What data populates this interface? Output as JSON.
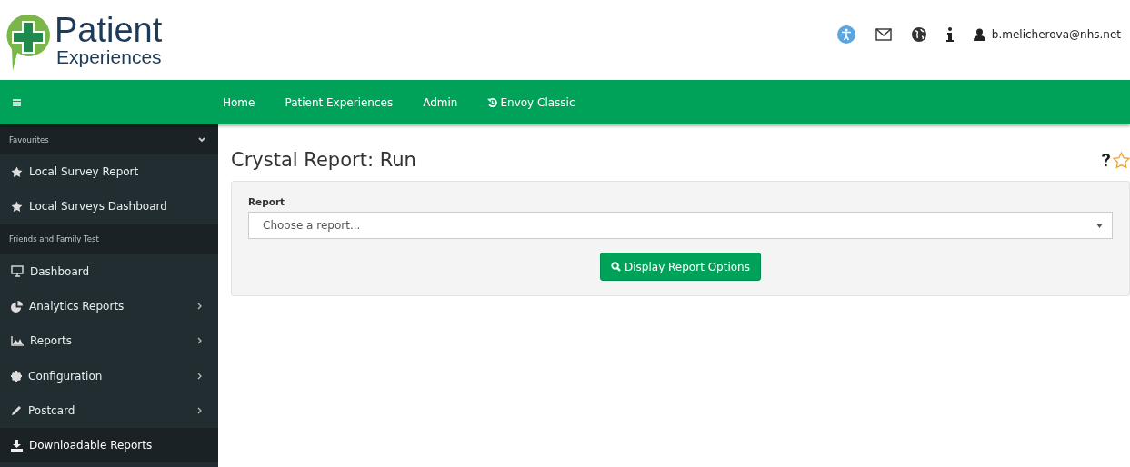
{
  "logo": {
    "line_1": "Patient",
    "line_2": "Experiences"
  },
  "user": {
    "email": "b.melicherova@nhs.net"
  },
  "nav": {
    "items": [
      {
        "label": "Home",
        "kind": "plain"
      },
      {
        "label": "Patient Experiences",
        "kind": "plain"
      },
      {
        "label": "Admin",
        "kind": "plain"
      },
      {
        "label": "Envoy Classic",
        "kind": "history"
      }
    ]
  },
  "sidebar": {
    "sections": [
      {
        "title": "Favourites",
        "expanded": true,
        "items": [
          {
            "label": "Local Survey Report",
            "has_submenu": false,
            "selected": false
          },
          {
            "label": "Local Surveys Dashboard",
            "has_submenu": false,
            "selected": false
          }
        ]
      },
      {
        "title": "Friends and Family Test",
        "items": [
          {
            "label": "Dashboard",
            "has_submenu": false,
            "selected": false
          },
          {
            "label": "Analytics Reports",
            "has_submenu": true,
            "selected": false
          },
          {
            "label": "Reports",
            "has_submenu": true,
            "selected": false
          },
          {
            "label": "Configuration",
            "has_submenu": true,
            "selected": false
          },
          {
            "label": "Postcard",
            "has_submenu": true,
            "selected": false
          },
          {
            "label": "Downloadable Reports",
            "has_submenu": false,
            "selected": true
          }
        ]
      }
    ]
  },
  "page": {
    "title": "Crystal Report: Run",
    "favourite": false,
    "form": {
      "label": "Report",
      "select_placeholder": "Choose a report...",
      "button": "Display Report Options"
    }
  }
}
